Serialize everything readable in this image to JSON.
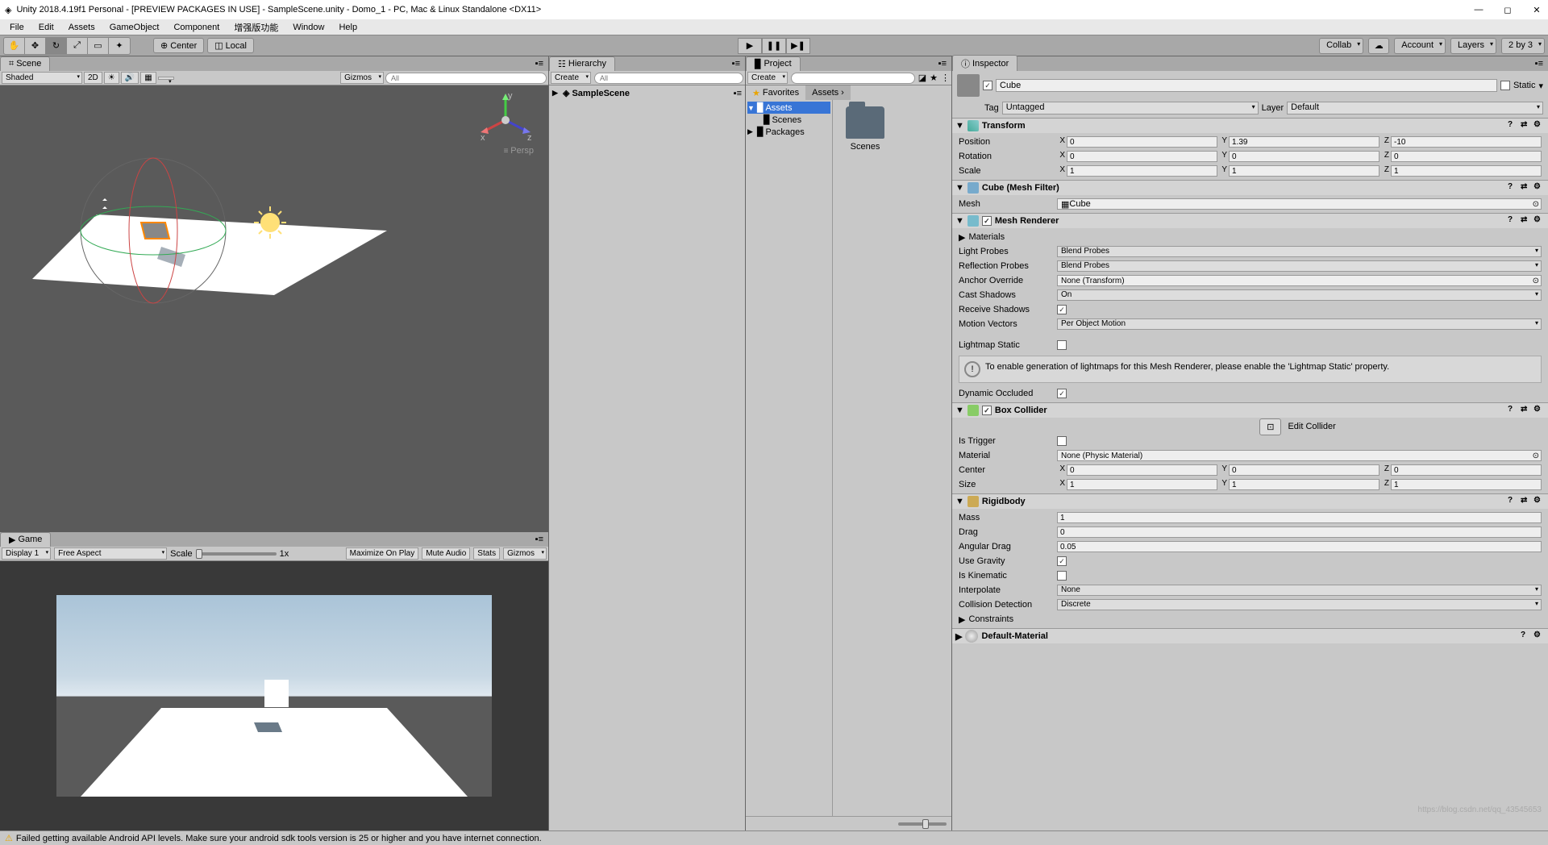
{
  "title": "Unity 2018.4.19f1 Personal - [PREVIEW PACKAGES IN USE] - SampleScene.unity - Domo_1 - PC, Mac & Linux Standalone <DX11>",
  "menubar": [
    "File",
    "Edit",
    "Assets",
    "GameObject",
    "Component",
    "增强版功能",
    "Window",
    "Help"
  ],
  "toolbar": {
    "center": "Center",
    "local": "Local",
    "collab": "Collab",
    "account": "Account",
    "layers": "Layers",
    "layout": "2 by 3"
  },
  "scene": {
    "tab": "Scene",
    "shaded": "Shaded",
    "mode2d": "2D",
    "gizmos": "Gizmos",
    "search_ph": "All",
    "persp": "Persp",
    "axes": {
      "x": "x",
      "y": "y",
      "z": "z"
    }
  },
  "game": {
    "tab": "Game",
    "display": "Display 1",
    "aspect": "Free Aspect",
    "scale_lbl": "Scale",
    "scale_val": "1x",
    "maxplay": "Maximize On Play",
    "mute": "Mute Audio",
    "stats": "Stats",
    "gizmos": "Gizmos"
  },
  "hierarchy": {
    "tab": "Hierarchy",
    "create": "Create",
    "search_ph": "All",
    "scene_name": "SampleScene"
  },
  "project": {
    "tab": "Project",
    "create": "Create",
    "favorites": "Favorites",
    "assets": "Assets",
    "scenes": "Scenes",
    "packages": "Packages",
    "grid_item": "Scenes"
  },
  "inspector": {
    "tab": "Inspector",
    "name": "Cube",
    "static_lbl": "Static",
    "tag_lbl": "Tag",
    "tag_val": "Untagged",
    "layer_lbl": "Layer",
    "layer_val": "Default",
    "transform": {
      "title": "Transform",
      "pos": "Position",
      "rot": "Rotation",
      "scale": "Scale",
      "px": "0",
      "py": "1.39",
      "pz": "-10",
      "rx": "0",
      "ry": "0",
      "rz": "0",
      "sx": "1",
      "sy": "1",
      "sz": "1"
    },
    "meshfilter": {
      "title": "Cube (Mesh Filter)",
      "mesh_lbl": "Mesh",
      "mesh_val": "Cube"
    },
    "renderer": {
      "title": "Mesh Renderer",
      "materials": "Materials",
      "lightprobes_lbl": "Light Probes",
      "lightprobes_val": "Blend Probes",
      "reflprobes_lbl": "Reflection Probes",
      "reflprobes_val": "Blend Probes",
      "anchor_lbl": "Anchor Override",
      "anchor_val": "None (Transform)",
      "castshadows_lbl": "Cast Shadows",
      "castshadows_val": "On",
      "recvshadows": "Receive Shadows",
      "motionvec_lbl": "Motion Vectors",
      "motionvec_val": "Per Object Motion",
      "lightmapstatic": "Lightmap Static",
      "info": "To enable generation of lightmaps for this Mesh Renderer, please enable the 'Lightmap Static' property.",
      "dynoccluded": "Dynamic Occluded"
    },
    "collider": {
      "title": "Box Collider",
      "edit": "Edit Collider",
      "istrigger": "Is Trigger",
      "material_lbl": "Material",
      "material_val": "None (Physic Material)",
      "center": "Center",
      "cx": "0",
      "cy": "0",
      "cz": "0",
      "size": "Size",
      "sx": "1",
      "sy": "1",
      "sz": "1"
    },
    "rigidbody": {
      "title": "Rigidbody",
      "mass_lbl": "Mass",
      "mass_val": "1",
      "drag_lbl": "Drag",
      "drag_val": "0",
      "angdrag_lbl": "Angular Drag",
      "angdrag_val": "0.05",
      "gravity": "Use Gravity",
      "kinematic": "Is Kinematic",
      "interp_lbl": "Interpolate",
      "interp_val": "None",
      "colldet_lbl": "Collision Detection",
      "colldet_val": "Discrete",
      "constraints": "Constraints"
    },
    "defmat": "Default-Material"
  },
  "status": "Failed getting available Android API levels. Make sure your android sdk tools version is 25 or higher and you have internet connection.",
  "watermark": "https://blog.csdn.net/qq_43545653"
}
